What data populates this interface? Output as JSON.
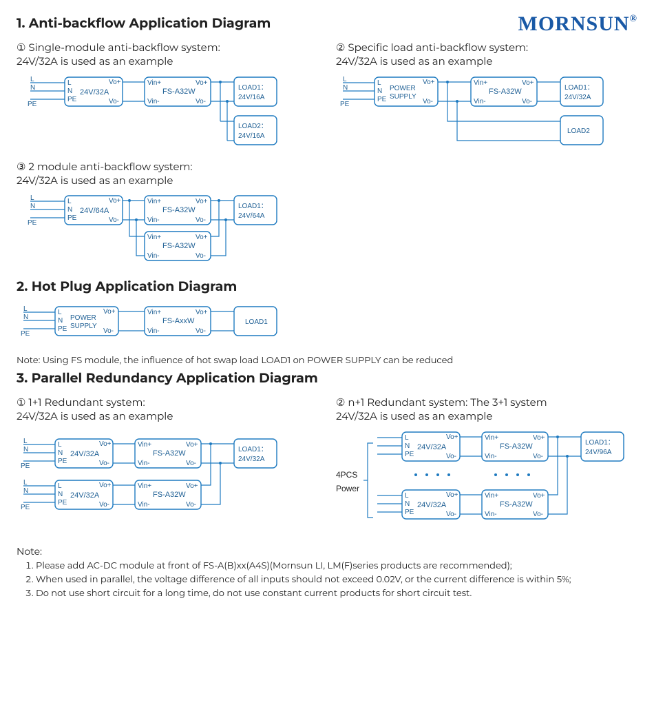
{
  "brand": "MORNSUN",
  "brand_reg": "®",
  "sections": {
    "s1": {
      "title": "1. Anti-backflow Application Diagram",
      "d1": {
        "caption_a": "① Single-module anti-backflow system:",
        "caption_b": "24V/32A is used as an example",
        "L": "L",
        "N": "N",
        "PE": "PE",
        "ps": "24V/32A",
        "vo_p": "Vo+",
        "vo_n": "Vo-",
        "vin_p": "Vin+",
        "vin_n": "Vin-",
        "mod": "FS-A32W",
        "load1": "LOAD1：",
        "load1v": "24V/16A",
        "load2": "LOAD2：",
        "load2v": "24V/16A"
      },
      "d2": {
        "caption_a": "② Specific load anti-backflow system:",
        "caption_b": "24V/32A is used as an example",
        "L": "L",
        "N": "N",
        "PE": "PE",
        "ps_a": "POWER",
        "ps_b": "SUPPLY",
        "vo_p": "Vo+",
        "vo_n": "Vo-",
        "vin_p": "Vin+",
        "vin_n": "Vin-",
        "mod": "FS-A32W",
        "load1": "LOAD1：",
        "load1v": "24V/32A",
        "load2": "LOAD2"
      },
      "d3": {
        "caption_a": "③ 2 module anti-backflow system:",
        "caption_b": "24V/32A is used as an example",
        "L": "L",
        "N": "N",
        "PE": "PE",
        "ps": "24V/64A",
        "vo_p": "Vo+",
        "vo_n": "Vo-",
        "vin_p": "Vin+",
        "vin_n": "Vin-",
        "mod": "FS-A32W",
        "load1": "LOAD1：",
        "load1v": "24V/64A"
      }
    },
    "s2": {
      "title": "2. Hot Plug Application Diagram",
      "d": {
        "L": "L",
        "N": "N",
        "PE": "PE",
        "ps_a": "POWER",
        "ps_b": "SUPPLY",
        "vo_p": "Vo+",
        "vo_n": "Vo-",
        "vin_p": "Vin+",
        "vin_n": "Vin-",
        "mod": "FS-AxxW",
        "load1": "LOAD1"
      },
      "note": "Note:  Using FS module, the influence of hot swap load LOAD1 on POWER SUPPLY can be reduced"
    },
    "s3": {
      "title": "3. Parallel Redundancy Application Diagram",
      "d1": {
        "caption_a": "① 1+1 Redundant system:",
        "caption_b": "24V/32A is used as an example",
        "L": "L",
        "N": "N",
        "PE": "PE",
        "ps": "24V/32A",
        "vo_p": "Vo+",
        "vo_n": "Vo-",
        "vin_p": "Vin+",
        "vin_n": "Vin-",
        "mod": "FS-A32W",
        "load1": "LOAD1：",
        "load1v": "24V/32A"
      },
      "d2": {
        "caption_a": "② n+1 Redundant system: The 3+1 system",
        "caption_b": "24V/32A is used as an example",
        "L": "L",
        "N": "N",
        "PE": "PE",
        "ps": "24V/32A",
        "vo_p": "Vo+",
        "vo_n": "Vo-",
        "vin_p": "Vin+",
        "vin_n": "Vin-",
        "mod": "FS-A32W",
        "load1": "LOAD1：",
        "load1v": "24V/96A",
        "four": "4PCS",
        "power": "Power"
      },
      "notes_label": "Note:",
      "notes": [
        "Please add AC-DC module at front of FS-A(B)xx(A4S)(Mornsun LI, LM(F)series products are recommended);",
        "When used in parallel, the voltage difference of all inputs should not exceed 0.02V, or the current difference is within 5%;",
        "Do not use short circuit for a long time, do not use constant current products for short circuit test."
      ]
    }
  }
}
